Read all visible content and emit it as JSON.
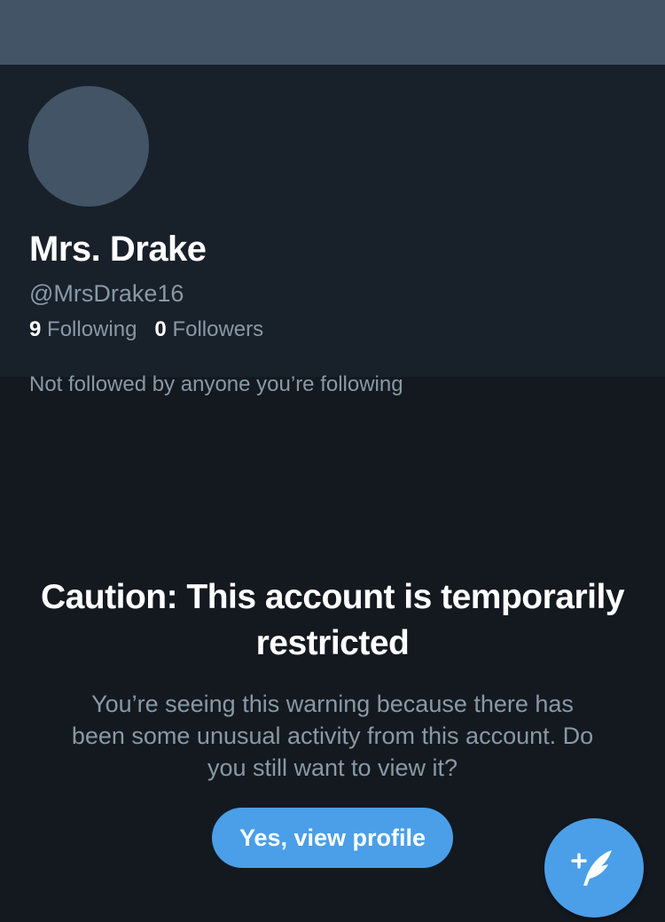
{
  "profile": {
    "display_name": "Mrs. Drake",
    "handle": "@MrsDrake16",
    "following_count": "9",
    "following_label": "Following",
    "followers_count": "0",
    "followers_label": "Followers",
    "followed_by": "Not followed by anyone you’re following"
  },
  "warning": {
    "title": "Caution: This account is temporarily restricted",
    "message": "You’re seeing this warning because there has been some unusual activity from this account. Do you still want to view it?",
    "button_label": "Yes, view profile"
  },
  "compose": {
    "icon": "compose-tweet-icon"
  },
  "colors": {
    "accent": "#4a9fe8",
    "background": "#141920",
    "panel": "#18202a",
    "banner": "#425466",
    "secondary_text": "#8899a6"
  }
}
